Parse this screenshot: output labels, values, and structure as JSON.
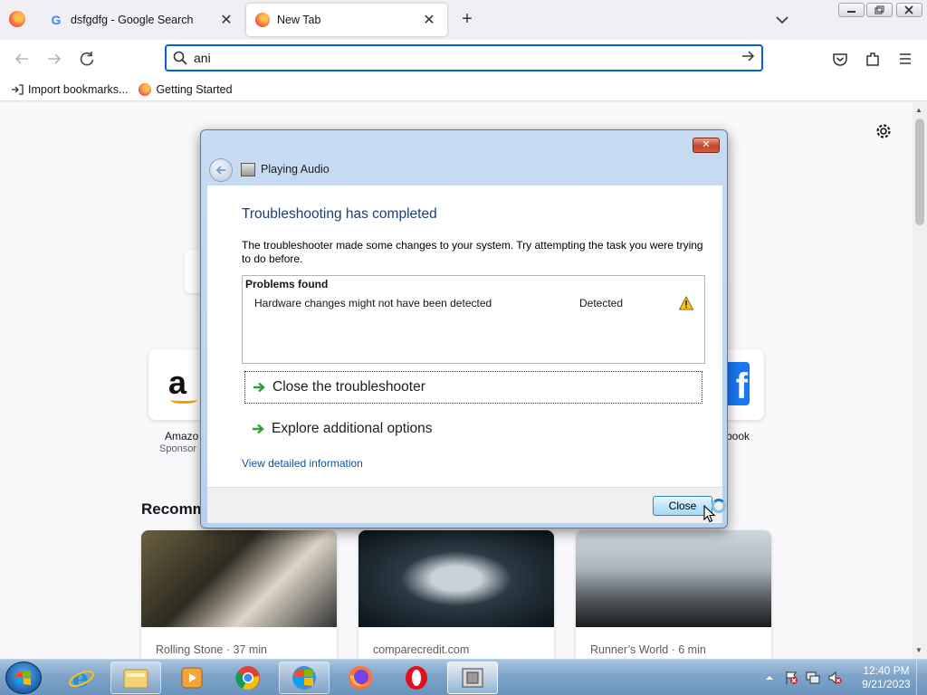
{
  "browser": {
    "tabs": [
      {
        "title": "dsfgdfg - Google Search",
        "favicon": "google-icon",
        "active": false
      },
      {
        "title": "New Tab",
        "favicon": "firefox-icon",
        "active": true
      }
    ],
    "tab_close_glyph": "✕",
    "new_tab_glyph": "+",
    "url_value": "ani",
    "bookmarks": [
      {
        "label": "Import bookmarks...",
        "icon": "import-icon"
      },
      {
        "label": "Getting Started",
        "icon": "firefox-icon"
      }
    ]
  },
  "newtab": {
    "shortcuts": [
      {
        "label": "Amazo",
        "sub": "Sponsor",
        "icon": "amazon-icon"
      },
      {
        "label": "book",
        "icon": "facebook-icon"
      }
    ],
    "amazon_glyph": "a",
    "facebook_glyph": "f",
    "recommended_heading": "Recomm",
    "cards": [
      {
        "source": "Rolling Stone · 37 min"
      },
      {
        "source": "comparecredit.com"
      },
      {
        "source": "Runner’s World · 6 min"
      }
    ]
  },
  "dialog": {
    "title": "Playing Audio",
    "close_glyph": "✕",
    "heading": "Troubleshooting has completed",
    "description": "The troubleshooter made some changes to your system. Try attempting the task you were trying to do before.",
    "problems_title": "Problems found",
    "problems": [
      {
        "name": "Hardware changes might not have been detected",
        "status": "Detected",
        "icon": "warning-icon"
      }
    ],
    "options": [
      {
        "label": "Close the troubleshooter"
      },
      {
        "label": "Explore additional options"
      }
    ],
    "detail_link": "View detailed information",
    "close_button": "Close"
  },
  "taskbar": {
    "items": [
      {
        "name": "internet-explorer-icon"
      },
      {
        "name": "file-explorer-icon"
      },
      {
        "name": "media-player-icon"
      },
      {
        "name": "chrome-icon"
      },
      {
        "name": "troubleshooter-icon"
      },
      {
        "name": "firefox-icon"
      },
      {
        "name": "opera-icon"
      },
      {
        "name": "dialog-app-icon"
      }
    ],
    "time": "12:40 PM",
    "date": "9/21/2023"
  },
  "colors": {
    "accent": "#0061e0",
    "dialog_heading": "#1c3e7a",
    "link": "#0b56a4",
    "taskbar": "#7fa4c8"
  }
}
